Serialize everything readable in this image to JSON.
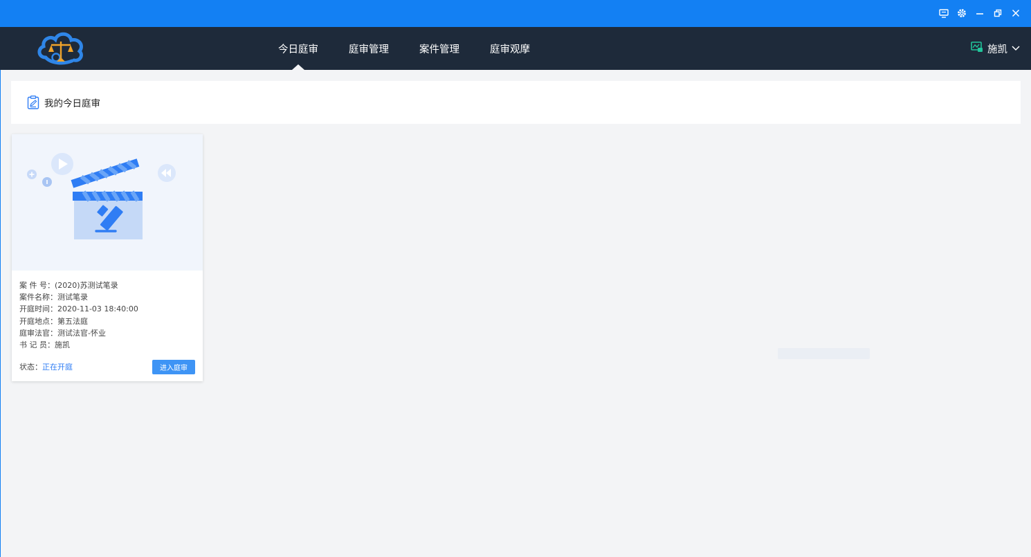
{
  "nav": {
    "tabs": [
      {
        "label": "今日庭审",
        "active": true
      },
      {
        "label": "庭审管理",
        "active": false
      },
      {
        "label": "案件管理",
        "active": false
      },
      {
        "label": "庭审观摩",
        "active": false
      }
    ],
    "user_name": "施凯"
  },
  "window_controls": [
    "monitor-icon",
    "gear-icon",
    "minimize-icon",
    "restore-icon",
    "close-icon"
  ],
  "section": {
    "title": "我的今日庭审"
  },
  "card": {
    "rows": [
      {
        "label": "案 件 号：",
        "value": "(2020)苏测试笔录"
      },
      {
        "label": "案件名称：",
        "value": "测试笔录"
      },
      {
        "label": "开庭时间：",
        "value": "2020-11-03 18:40:00"
      },
      {
        "label": "开庭地点：",
        "value": "第五法庭"
      },
      {
        "label": "庭审法官：",
        "value": "测试法官-怀业"
      },
      {
        "label": "书 记 员：",
        "value": "施凯"
      }
    ],
    "status_label": "状态：",
    "status_value": "正在开庭",
    "enter_button": "进入庭审"
  },
  "colors": {
    "titlebar": "#1380f3",
    "navbar": "#1e2a3a",
    "accent": "#2f7df4",
    "button": "#3e94f5",
    "status_icon": "#21c49a"
  }
}
